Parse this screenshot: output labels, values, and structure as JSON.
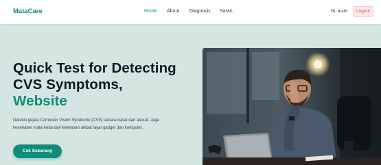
{
  "navbar": {
    "brand": "MataCare",
    "links": [
      {
        "label": "Home",
        "active": true
      },
      {
        "label": "About",
        "active": false
      },
      {
        "label": "Diagnosis",
        "active": false
      },
      {
        "label": "Saran",
        "active": false
      }
    ],
    "greeting": "Hi, andri",
    "logout_label": "Logout"
  },
  "hero": {
    "title_line1": "Quick Test for Detecting",
    "title_line2": "CVS Symptoms,",
    "title_line3": "Website",
    "description": "Deteksi gejala Computer Vision Syndrome (CVS) secara cepat dan akurat. Jaga kesehatan mata Anda dari kelelahan akibat layar gadget dan komputer.",
    "cta_label": "Cek Sekarang"
  },
  "colors": {
    "accent": "#0f8d7a",
    "background": "#d4e6e1",
    "logout": "#e0485e"
  },
  "image": {
    "subject": "man rubbing eyes in front of laptop"
  }
}
